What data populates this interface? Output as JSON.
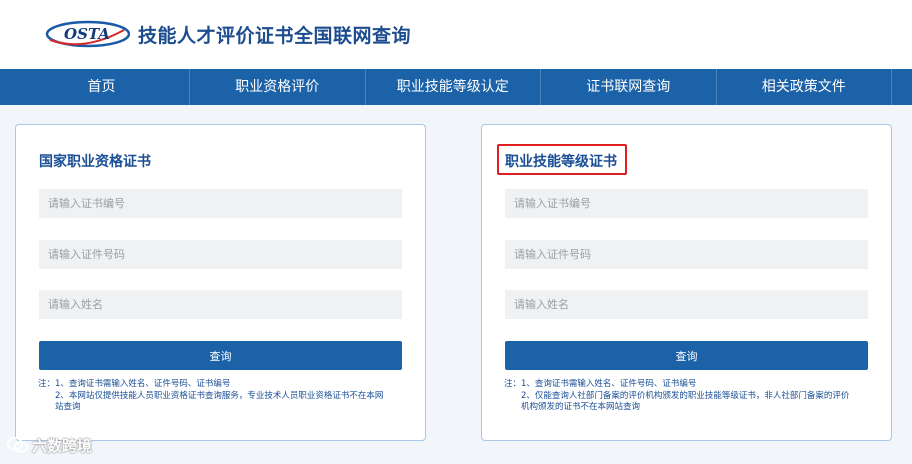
{
  "header": {
    "logo_text": "OSTA",
    "title": "技能人才评价证书全国联网查询"
  },
  "nav": {
    "items": [
      "首页",
      "职业资格评价",
      "职业技能等级认定",
      "证书联网查询",
      "相关政策文件"
    ]
  },
  "cards": [
    {
      "title": "国家职业资格证书",
      "fields": {
        "cert_no_placeholder": "请输入证书编号",
        "id_no_placeholder": "请输入证件号码",
        "name_placeholder": "请输入姓名"
      },
      "button_label": "查询",
      "notes": [
        "注：1、查询证书需输入姓名、证件号码、证书编号",
        "2、本网站仅提供技能人员职业资格证书查询服务，专业技术人员职业资格证书不在本网",
        "站查询"
      ]
    },
    {
      "title": "职业技能等级证书",
      "fields": {
        "cert_no_placeholder": "请输入证书编号",
        "id_no_placeholder": "请输入证件号码",
        "name_placeholder": "请输入姓名"
      },
      "button_label": "查询",
      "notes": [
        "注：1、查询证书需输入姓名、证件号码、证书编号",
        "2、仅能查询人社部门备案的评价机构颁发的职业技能等级证书，非人社部门备案的评价",
        "机构颁发的证书不在本网站查询"
      ]
    }
  ],
  "watermark": {
    "text": "六数跨境"
  },
  "colors": {
    "nav_bg": "#1b62a8",
    "title_blue": "#1a4f95",
    "highlight": "#e02020"
  }
}
